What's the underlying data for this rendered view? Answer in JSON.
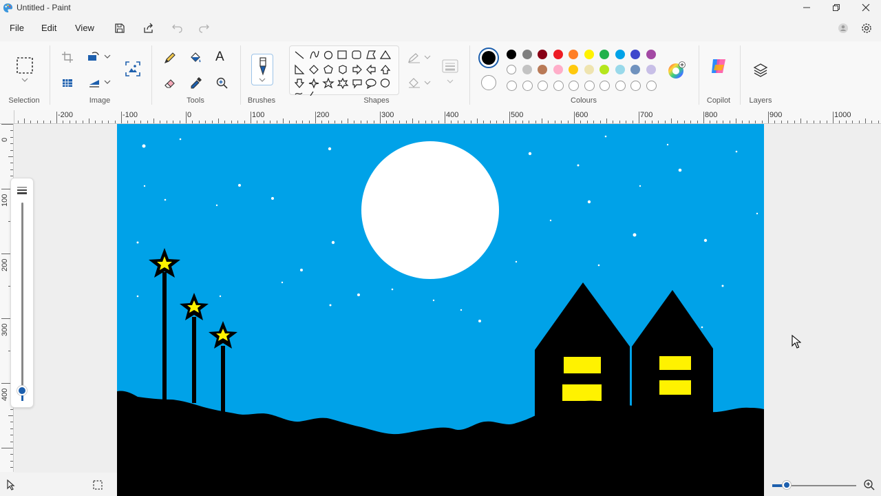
{
  "window": {
    "title": "Untitled - Paint"
  },
  "menu": {
    "file": "File",
    "edit": "Edit",
    "view": "View"
  },
  "ribbon": {
    "groups": {
      "selection": "Selection",
      "image": "Image",
      "tools": "Tools",
      "brushes": "Brushes",
      "shapes": "Shapes",
      "colours": "Colours",
      "copilot": "Copilot",
      "layers": "Layers"
    },
    "text_tool_glyph": "A",
    "primary_color": "#000000",
    "secondary_color": "#ffffff",
    "palette_row1": [
      "#000000",
      "#7f7f7f",
      "#880015",
      "#ed1c24",
      "#ff7f27",
      "#fff200",
      "#22b14c",
      "#00a2e8",
      "#3f48cc",
      "#a349a4"
    ],
    "palette_row2": [
      "#ffffff",
      "#c3c3c3",
      "#b97a57",
      "#ffaec9",
      "#ffc90e",
      "#efe4b0",
      "#b5e61d",
      "#99d9ea",
      "#7092be",
      "#c8bfe7"
    ],
    "palette_row3_empty_count": 10
  },
  "ruler": {
    "horizontal": [
      "-200",
      "-100",
      "0",
      "100",
      "200",
      "300",
      "400",
      "500",
      "600",
      "700",
      "800",
      "900",
      "1000"
    ],
    "vertical": [
      "0",
      "100",
      "200",
      "300",
      "400"
    ]
  },
  "canvas_colors": {
    "sky": "#00a2e8",
    "moon": "#ffffff",
    "silhouette": "#000000",
    "window": "#fff200",
    "star": "#fff200"
  }
}
